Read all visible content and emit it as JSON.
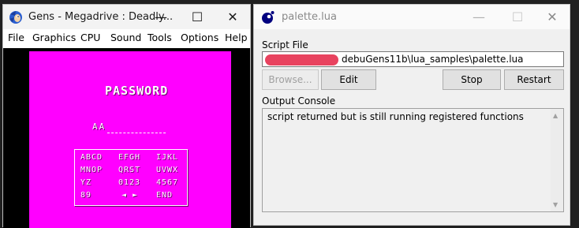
{
  "gens": {
    "title": "Gens - Megadrive : Deadly...",
    "menu": [
      "File",
      "Graphics",
      "CPU",
      "Sound",
      "Tools",
      "Options",
      "Help"
    ],
    "caption": {
      "minimize": "—",
      "maximize": "☐",
      "close": "✕"
    },
    "game": {
      "heading": "PASSWORD",
      "entry": "AA",
      "grid": [
        [
          "ABCD",
          "EFGH",
          "IJKL"
        ],
        [
          "MNOP",
          "QRST",
          "UVWX"
        ],
        [
          "YZ",
          "0123",
          "4567"
        ],
        [
          "89",
          "◄ ►",
          "END"
        ]
      ],
      "colors": {
        "background": "#ff00ff",
        "text": "#ffffff"
      }
    }
  },
  "lua": {
    "title": "palette.lua",
    "caption": {
      "minimize": "—",
      "maximize": "☐",
      "close": "✕"
    },
    "script_file_label": "Script File",
    "script_path_visible": "debuGens11b\\lua_samples\\palette.lua",
    "buttons": {
      "browse": "Browse...",
      "edit": "Edit",
      "stop": "Stop",
      "restart": "Restart"
    },
    "output_console_label": "Output Console",
    "output_text": "script returned but is still running registered functions"
  }
}
